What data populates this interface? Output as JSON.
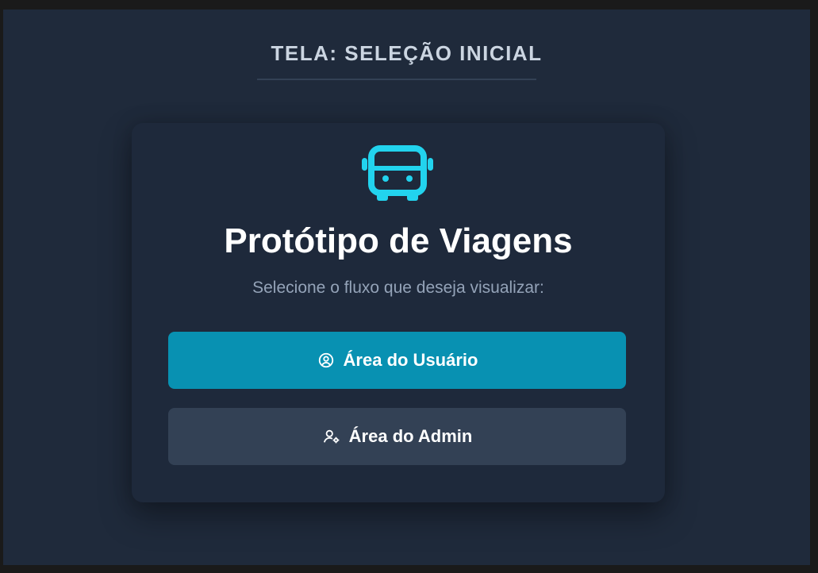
{
  "screen": {
    "title": "TELA: SELEÇÃO INICIAL"
  },
  "card": {
    "icon": "bus-icon",
    "title": "Protótipo de Viagens",
    "subtitle": "Selecione o fluxo que deseja visualizar:"
  },
  "buttons": {
    "user": {
      "label": "Área do Usuário",
      "icon": "user-circle-icon"
    },
    "admin": {
      "label": "Área do Admin",
      "icon": "user-cog-icon"
    }
  },
  "colors": {
    "background": "#1f2a3b",
    "card": "#1e293b",
    "accent": "#22d3ee",
    "primary_button": "#0891b2",
    "secondary_button": "#334155"
  }
}
